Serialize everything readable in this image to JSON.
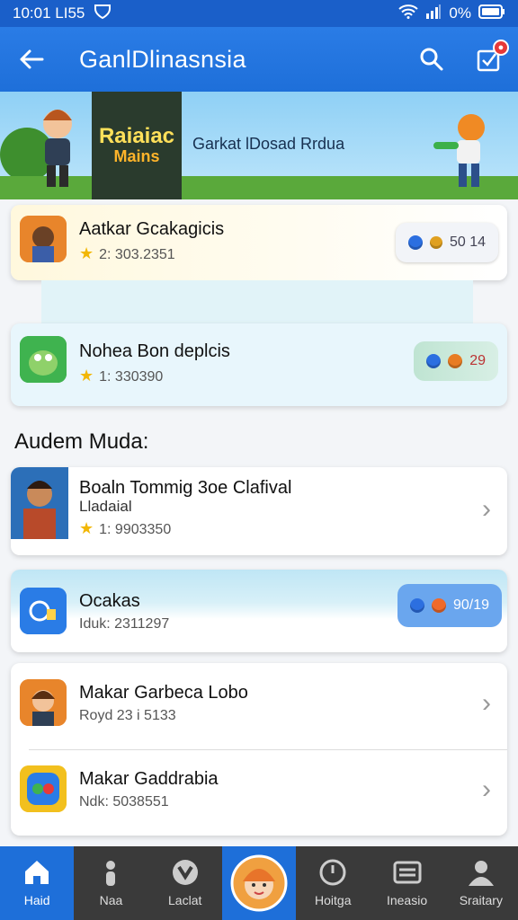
{
  "status": {
    "time": "10:01 LI55",
    "battery": "0%"
  },
  "appbar": {
    "title": "GanlDlinasnsia"
  },
  "banner": {
    "poster_line1": "Raiaiac",
    "poster_line2": "Mains",
    "caption": "Garkat lDosad Rrdua"
  },
  "featured": [
    {
      "name": "Aatkar Gcakagicis",
      "rating": "2: 303.2351",
      "pill": "50 14",
      "accent": "#f0b400"
    },
    {
      "name": "Nohea Bon deplcis",
      "rating": "1: 330390",
      "pill": "29",
      "accent": "#2e9a3e"
    }
  ],
  "section_title": "Audem Muda:",
  "list": [
    {
      "name": "Boaln Tommig 3oe Clafival",
      "sub": "Lladaial",
      "rating": "1: 9903350"
    },
    {
      "name": "Ocakas",
      "meta": "Iduk: 2311297",
      "pill": "90/19"
    },
    {
      "name": "Makar Garbeca Lobo",
      "meta": "Royd 23 i 5133"
    },
    {
      "name": "Makar Gaddrabia",
      "meta": "Ndk: 5038551"
    }
  ],
  "tabs": [
    "Haid",
    "Naa",
    "Laclat",
    "",
    "Hoitga",
    "Ineasio",
    "Sraitary"
  ]
}
